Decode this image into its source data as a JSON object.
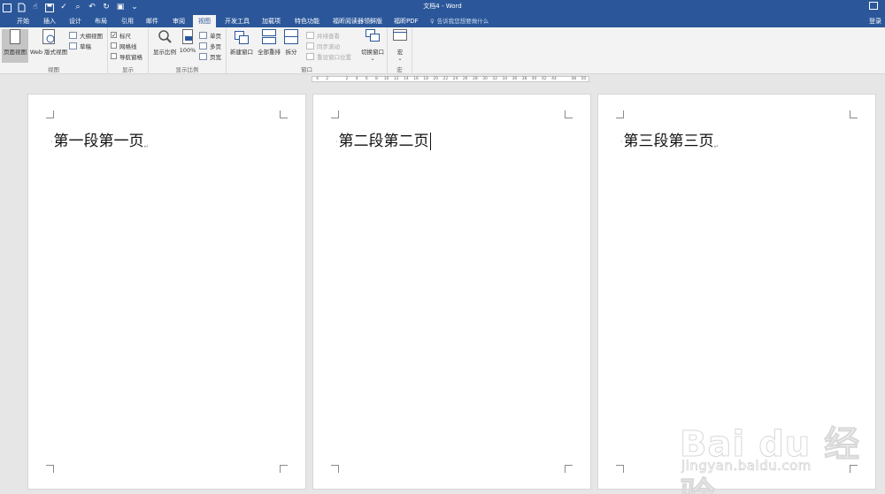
{
  "window": {
    "title": "文档4 - Word",
    "login": "登录"
  },
  "tabs": [
    "开始",
    "插入",
    "设计",
    "布局",
    "引用",
    "邮件",
    "审阅",
    "视图",
    "开发工具",
    "加载项",
    "特色功能",
    "福昕阅读器领鲜版",
    "福昕PDF"
  ],
  "active_tab": "视图",
  "tell_me": {
    "placeholder": "告诉我您想要做什么"
  },
  "ribbon": {
    "views": {
      "label": "视图",
      "print_layout": "页面视图",
      "web_layout": "Web 版式视图",
      "outline": "大纲视图",
      "draft": "草稿"
    },
    "show": {
      "label": "显示",
      "ruler": "标尺",
      "gridlines": "网格线",
      "nav_pane": "导航窗格",
      "ruler_checked": true
    },
    "zoom": {
      "label": "显示比例",
      "zoom": "显示比例",
      "hundred": "100%",
      "one_page": "单页",
      "multi_page": "多页",
      "page_width": "页宽"
    },
    "window": {
      "label": "窗口",
      "new_window": "新建窗口",
      "arrange_all": "全部重排",
      "split": "拆分",
      "side_by_side": "并排查看",
      "sync_scroll": "同步滚动",
      "reset_pos": "重设窗口位置",
      "switch": "切换窗口"
    },
    "macros": {
      "label": "宏",
      "macro": "宏"
    }
  },
  "ruler_ticks": [
    "4",
    "2",
    "",
    "2",
    "4",
    "6",
    "8",
    "10",
    "12",
    "14",
    "16",
    "18",
    "20",
    "22",
    "24",
    "26",
    "28",
    "30",
    "32",
    "34",
    "36",
    "38",
    "40",
    "42",
    "44",
    "",
    "48",
    "50"
  ],
  "pages": [
    {
      "text": "第一段第一页"
    },
    {
      "text": "第二段第二页"
    },
    {
      "text": "第三段第三页"
    }
  ],
  "watermark": {
    "logo": "Bai du 经验",
    "url": "jingyan.baidu.com"
  },
  "colors": {
    "title_bar": "#2b579a",
    "ribbon": "#f3f3f3",
    "canvas": "#e6e6e6"
  }
}
